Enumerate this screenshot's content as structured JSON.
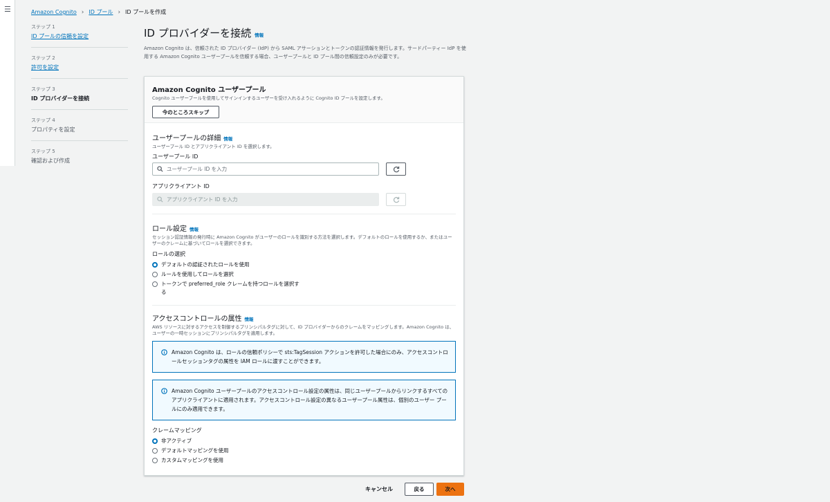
{
  "nav": {
    "menu_icon": "hamburger-icon"
  },
  "breadcrumb": {
    "items": [
      "Amazon Cognito",
      "ID プール",
      "ID プールを作成"
    ]
  },
  "steps": [
    {
      "num": "ステップ 1",
      "title": "ID プールの信頼を設定"
    },
    {
      "num": "ステップ 2",
      "title": "許可を設定"
    },
    {
      "num": "ステップ 3",
      "title": "ID プロバイダーを接続"
    },
    {
      "num": "ステップ 4",
      "title": "プロパティを設定"
    },
    {
      "num": "ステップ 5",
      "title": "確認および作成"
    }
  ],
  "page": {
    "title": "ID プロバイダーを接続",
    "info": "情報",
    "description": "Amazon Cognito は、信頼された ID プロバイダー (IdP) から SAML アサーションとトークンの認証情報を発行します。サードパーティー IdP を使用する Amazon Cognito ユーザープールを信頼する場合、ユーザープールと ID プール間の信頼設定のみが必要です。"
  },
  "userpool_panel": {
    "title": "Amazon Cognito ユーザープール",
    "description": "Cognito ユーザープールを使用してサインインするユーザーを受け入れるように Cognito ID プールを設定します。",
    "skip_label": "今のところスキップ"
  },
  "details": {
    "title": "ユーザープールの詳細",
    "info": "情報",
    "description": "ユーザープール ID とアプリクライアント ID を選択します。",
    "pool_id_label": "ユーザープール ID",
    "pool_id_placeholder": "ユーザープール ID を入力",
    "client_id_label": "アプリクライアント ID",
    "client_id_placeholder": "アプリクライアント ID を入力"
  },
  "role": {
    "title": "ロール設定",
    "info": "情報",
    "description": "セッション認証情報の発行時に Amazon Cognito がユーザーのロールを識別する方法を選択します。デフォルトのロールを使用するか、またはユーザーのクレームに基づいてロールを選択できます。",
    "select_label": "ロールの選択",
    "options": [
      {
        "label": "デフォルトの認証されたロールを使用",
        "selected": true
      },
      {
        "label": "ルールを使用してロールを選択",
        "selected": false
      },
      {
        "label": "トークンで preferred_role クレームを持つロールを選択する",
        "selected": false
      }
    ]
  },
  "access": {
    "title": "アクセスコントロールの属性",
    "info": "情報",
    "description": "AWS リソースに対するアクセスを制御するプリンシパルタグに対して、ID プロバイダーからのクレームをマッピングします。Amazon Cognito は、ユーザーの一時セッションにプリンシパルタグを適用します。",
    "alert1": "Amazon Cognito は、ロールの信頼ポリシーで sts:TagSession アクションを許可した場合にのみ、アクセスコントロールセッションタグの属性を IAM ロールに渡すことができます。",
    "alert2": "Amazon Cognito ユーザープールのアクセスコントロール設定の属性は、同じユーザープールからリンクするすべてのアプリクライアントに適用されます。アクセスコントロール設定の異なるユーザープール属性は、個別のユーザー プールにのみ適用できます。",
    "claim_label": "クレームマッピング",
    "options": [
      {
        "label": "非アクティブ",
        "selected": true
      },
      {
        "label": "デフォルトマッピングを使用",
        "selected": false
      },
      {
        "label": "カスタムマッピングを使用",
        "selected": false
      }
    ]
  },
  "footer": {
    "cancel": "キャンセル",
    "back": "戻る",
    "next": "次へ"
  },
  "colors": {
    "accent": "#0073bb",
    "primary_button": "#ec7211",
    "background": "#f2f3f3"
  }
}
